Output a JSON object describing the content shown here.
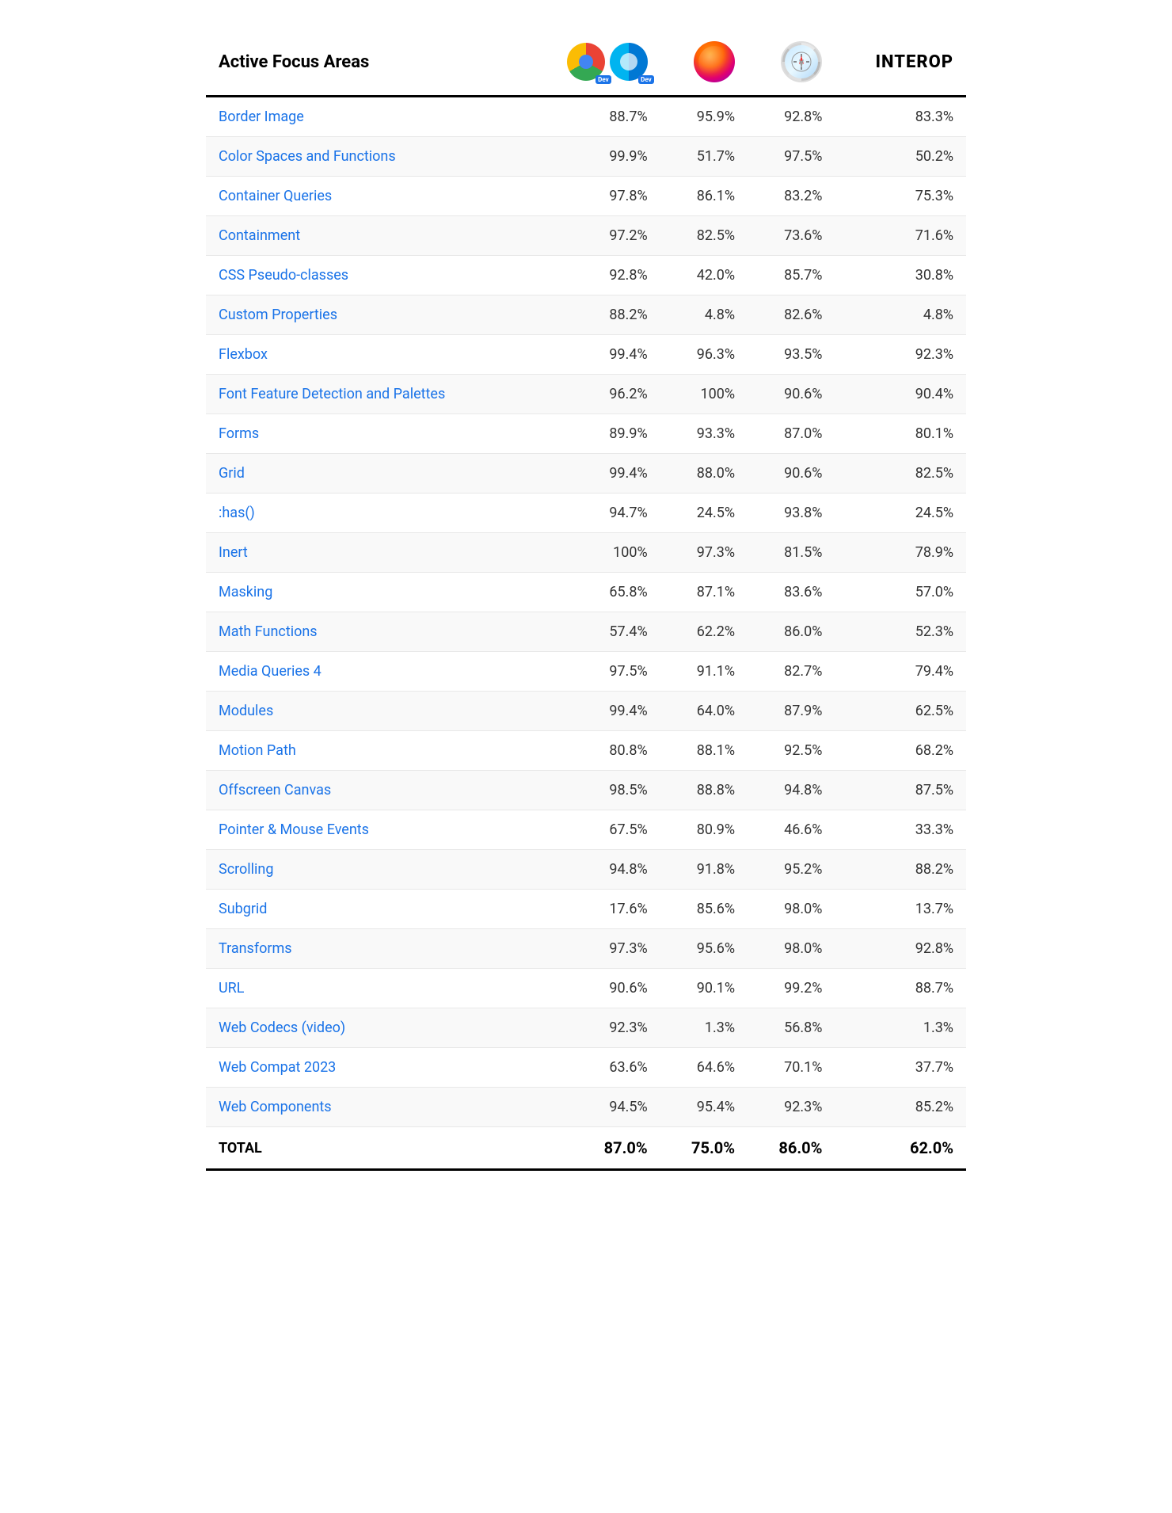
{
  "header": {
    "col1": "Active Focus Areas",
    "col2_label": "Chrome/Edge Dev",
    "col3_label": "Firefox",
    "col4_label": "Safari",
    "col5": "INTEROP"
  },
  "rows": [
    {
      "name": "Border Image",
      "chrome": "88.7%",
      "firefox": "95.9%",
      "safari": "92.8%",
      "interop": "83.3%"
    },
    {
      "name": "Color Spaces and Functions",
      "chrome": "99.9%",
      "firefox": "51.7%",
      "safari": "97.5%",
      "interop": "50.2%"
    },
    {
      "name": "Container Queries",
      "chrome": "97.8%",
      "firefox": "86.1%",
      "safari": "83.2%",
      "interop": "75.3%"
    },
    {
      "name": "Containment",
      "chrome": "97.2%",
      "firefox": "82.5%",
      "safari": "73.6%",
      "interop": "71.6%"
    },
    {
      "name": "CSS Pseudo-classes",
      "chrome": "92.8%",
      "firefox": "42.0%",
      "safari": "85.7%",
      "interop": "30.8%"
    },
    {
      "name": "Custom Properties",
      "chrome": "88.2%",
      "firefox": "4.8%",
      "safari": "82.6%",
      "interop": "4.8%"
    },
    {
      "name": "Flexbox",
      "chrome": "99.4%",
      "firefox": "96.3%",
      "safari": "93.5%",
      "interop": "92.3%"
    },
    {
      "name": "Font Feature Detection and Palettes",
      "chrome": "96.2%",
      "firefox": "100%",
      "safari": "90.6%",
      "interop": "90.4%"
    },
    {
      "name": "Forms",
      "chrome": "89.9%",
      "firefox": "93.3%",
      "safari": "87.0%",
      "interop": "80.1%"
    },
    {
      "name": "Grid",
      "chrome": "99.4%",
      "firefox": "88.0%",
      "safari": "90.6%",
      "interop": "82.5%"
    },
    {
      "name": ":has()",
      "chrome": "94.7%",
      "firefox": "24.5%",
      "safari": "93.8%",
      "interop": "24.5%"
    },
    {
      "name": "Inert",
      "chrome": "100%",
      "firefox": "97.3%",
      "safari": "81.5%",
      "interop": "78.9%"
    },
    {
      "name": "Masking",
      "chrome": "65.8%",
      "firefox": "87.1%",
      "safari": "83.6%",
      "interop": "57.0%"
    },
    {
      "name": "Math Functions",
      "chrome": "57.4%",
      "firefox": "62.2%",
      "safari": "86.0%",
      "interop": "52.3%"
    },
    {
      "name": "Media Queries 4",
      "chrome": "97.5%",
      "firefox": "91.1%",
      "safari": "82.7%",
      "interop": "79.4%"
    },
    {
      "name": "Modules",
      "chrome": "99.4%",
      "firefox": "64.0%",
      "safari": "87.9%",
      "interop": "62.5%"
    },
    {
      "name": "Motion Path",
      "chrome": "80.8%",
      "firefox": "88.1%",
      "safari": "92.5%",
      "interop": "68.2%"
    },
    {
      "name": "Offscreen Canvas",
      "chrome": "98.5%",
      "firefox": "88.8%",
      "safari": "94.8%",
      "interop": "87.5%"
    },
    {
      "name": "Pointer & Mouse Events",
      "chrome": "67.5%",
      "firefox": "80.9%",
      "safari": "46.6%",
      "interop": "33.3%"
    },
    {
      "name": "Scrolling",
      "chrome": "94.8%",
      "firefox": "91.8%",
      "safari": "95.2%",
      "interop": "88.2%"
    },
    {
      "name": "Subgrid",
      "chrome": "17.6%",
      "firefox": "85.6%",
      "safari": "98.0%",
      "interop": "13.7%"
    },
    {
      "name": "Transforms",
      "chrome": "97.3%",
      "firefox": "95.6%",
      "safari": "98.0%",
      "interop": "92.8%"
    },
    {
      "name": "URL",
      "chrome": "90.6%",
      "firefox": "90.1%",
      "safari": "99.2%",
      "interop": "88.7%"
    },
    {
      "name": "Web Codecs (video)",
      "chrome": "92.3%",
      "firefox": "1.3%",
      "safari": "56.8%",
      "interop": "1.3%"
    },
    {
      "name": "Web Compat 2023",
      "chrome": "63.6%",
      "firefox": "64.6%",
      "safari": "70.1%",
      "interop": "37.7%"
    },
    {
      "name": "Web Components",
      "chrome": "94.5%",
      "firefox": "95.4%",
      "safari": "92.3%",
      "interop": "85.2%"
    }
  ],
  "total": {
    "label": "TOTAL",
    "chrome": "87.0%",
    "firefox": "75.0%",
    "safari": "86.0%",
    "interop": "62.0%"
  }
}
